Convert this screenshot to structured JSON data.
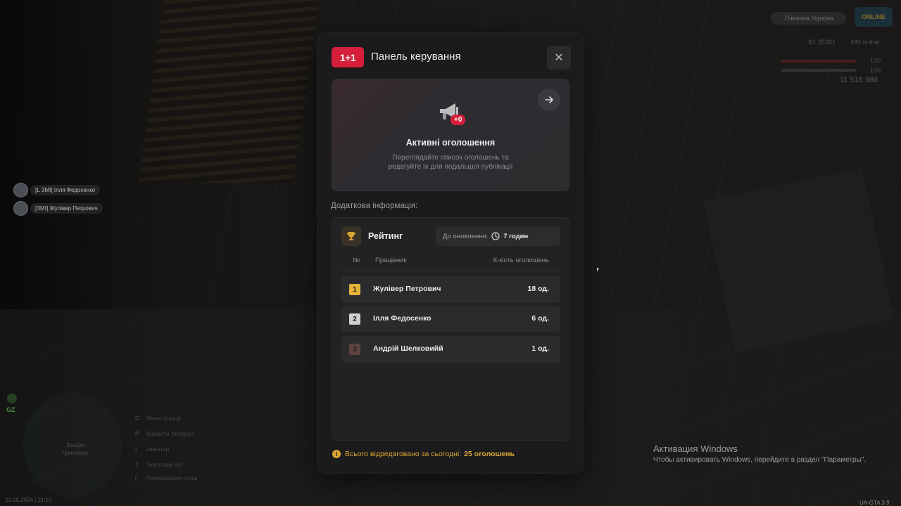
{
  "modal": {
    "logo_text": "1+1",
    "title": "Панель керування",
    "close_glyph": "✕"
  },
  "announcement_card": {
    "badge": "+0",
    "title": "Активні оголошення",
    "description": "Переглядайте список оголошень та редагуйте їх для подальшої публікації",
    "icon": "megaphone-icon",
    "arrow_icon": "arrow-right-icon"
  },
  "additional": {
    "section_label": "Додаткова інформація:",
    "rating_title": "Рейтинг",
    "update_label": "До оновлення:",
    "update_value": "7 годин",
    "columns": [
      "№",
      "Працівник",
      "К-кість оголошень"
    ],
    "rows": [
      {
        "rank": "1",
        "name": "Жулівер Петрович",
        "count": "18 од.",
        "rank_color": "#e6b33a"
      },
      {
        "rank": "2",
        "name": "Ілля Федосенко",
        "count": "6 од.",
        "rank_color": "#cfcfd1"
      },
      {
        "rank": "3",
        "name": "Андрій Шелковийй",
        "count": "1 од.",
        "rank_color": "#5a4440"
      }
    ]
  },
  "footer": {
    "text": "Всього відредаговано за сьогодні:",
    "value": "25 оголошень"
  },
  "background_hud": {
    "players": [
      "[L ЗМІ] Ілля Федосенко",
      "[ЗМІ] Жулівер Петрович"
    ],
    "server": "Північна Україна",
    "server_logo": "ONLINE",
    "id_line": "ID: 25381",
    "online": "480 online",
    "hp": "100",
    "armor": "100",
    "money": "11 518 988",
    "gz": "GZ",
    "minimap_text": "Західні тренувань",
    "hints": [
      {
        "key": "O",
        "label": "Меню гравця"
      },
      {
        "key": "P",
        "label": "Відкрити телефон"
      },
      {
        "key": "I",
        "label": "Інвентар"
      },
      {
        "key": "T",
        "label": "Текстовий чат"
      },
      {
        "key": "[",
        "label": "Переміщення площ"
      }
    ],
    "datetime": "22.05.2024 | 21:57",
    "version": "UA-GTA 3.9"
  },
  "windows_activation": {
    "title": "Активация Windows",
    "subtitle": "Чтобы активировать Windows, перейдите в раздел \"Параметры\"."
  },
  "colors": {
    "brand_red": "#d51e3a",
    "gold": "#d9a532",
    "modal_bg": "#1b1b1d"
  }
}
